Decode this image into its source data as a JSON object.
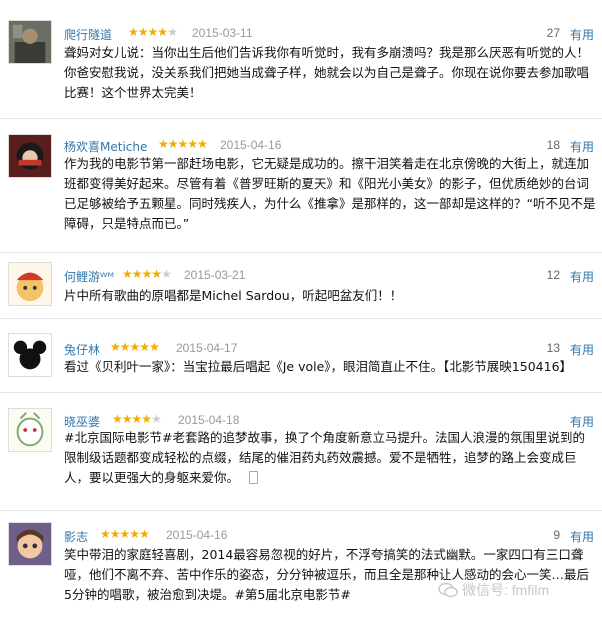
{
  "comments": [
    {
      "user": "爬行隧道",
      "rating": 4,
      "date": "2015-03-11",
      "votes": "27",
      "useful": "有用",
      "text": "聋妈对女儿说：当你出生后他们告诉我你有听觉时，我有多崩溃吗？我是那么厌恶有听觉的人！你爸安慰我说，没关系我们把她当成聋子样，她就会以为自己是聋子。你现在说你要去参加歌唱比赛！这个世界太完美！"
    },
    {
      "user": "杨欢喜Metiche",
      "rating": 5,
      "date": "2015-04-16",
      "votes": "18",
      "useful": "有用",
      "text": "作为我的电影节第一部赶场电影，它无疑是成功的。擦干泪笑着走在北京傍晚的大街上，就连加班都变得美好起来。尽管有着《普罗旺斯的夏天》和《阳光小美女》的影子，但优质绝妙的台词已足够被给予五颗星。同时残疾人，为什么《推拿》是那样的，这一部却是这样的？“听不见不是障碍，只是特点而已。”"
    },
    {
      "user": "何鲤游ᵂᴹ",
      "rating": 4,
      "date": "2015-03-21",
      "votes": "12",
      "useful": "有用",
      "text": "片中所有歌曲的原唱都是Michel Sardou，听起吧盆友们！！"
    },
    {
      "user": "兔仔林",
      "rating": 5,
      "date": "2015-04-17",
      "votes": "13",
      "useful": "有用",
      "text": "看过《贝利叶一家》：当宝拉最后唱起《Je vole》，眼泪简直止不住。【北影节展映150416】"
    },
    {
      "user": "晓巫婆",
      "rating": 4,
      "date": "2015-04-18",
      "votes": "",
      "useful": "有用",
      "text": "#北京国际电影节#老套路的追梦故事，换了个角度新意立马提升。法国人浪漫的氛围里说到的限制级话题都变成轻松的点缀，结尾的催泪药丸药效震撼。爱不是牺牲，追梦的路上会变成巨人，要以更强大的身躯来爱你。"
    },
    {
      "user": "影志",
      "rating": 5,
      "date": "2015-04-16",
      "votes": "9",
      "useful": "有用",
      "text": "笑中带泪的家庭轻喜剧，2014最容易忽视的好片，不浮夸搞笑的法式幽默。一家四口有三口聋哑，他们不离不弃、苦中作乐的姿态，分分钟被逗乐，而且全是那种让人感动的会心一笑…最后5分钟的唱歌，被治愈到决堤。#第5届北京电影节#"
    }
  ],
  "watermark": "微信号: fmfilm",
  "colors": {
    "link": "#3377aa",
    "star": "#f6ab00"
  }
}
